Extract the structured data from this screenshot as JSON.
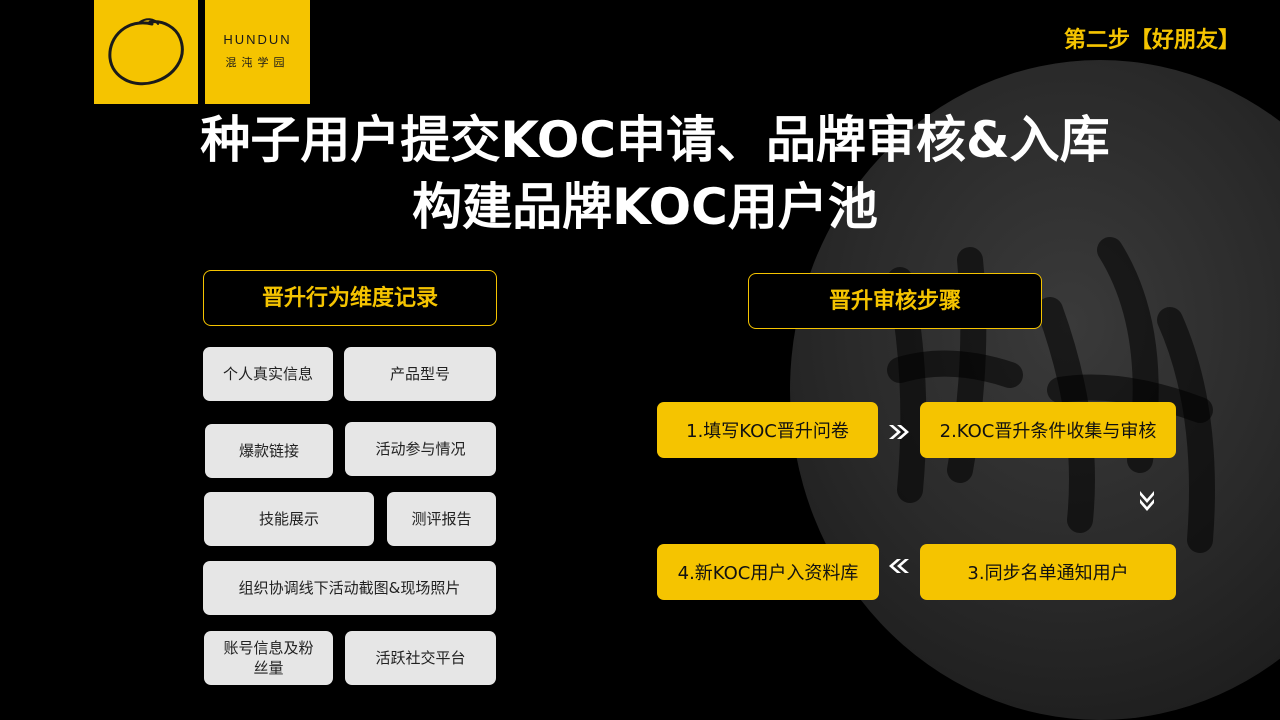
{
  "logo": {
    "en": "HUNDUN",
    "cn": "混沌学园"
  },
  "step_label": "第二步【好朋友】",
  "title": {
    "line1": "种子用户提交KOC申请、品牌审核&入库",
    "line2": "构建品牌KOC用户池"
  },
  "left": {
    "header": "晋升行为维度记录",
    "items": [
      "个人真实信息",
      "产品型号",
      "爆款链接",
      "活动参与情况",
      "技能展示",
      "测评报告",
      "组织协调线下活动截图&现场照片",
      "账号信息及粉丝量",
      "活跃社交平台"
    ]
  },
  "right": {
    "header": "晋升审核步骤",
    "steps": [
      "1.填写KOC晋升问卷",
      "2.KOC晋升条件收集与审核",
      "3.同步名单通知用户",
      "4.新KOC用户入资料库"
    ]
  },
  "colors": {
    "accent": "#f5c400",
    "chip": "#e6e6e6",
    "background": "#000000"
  },
  "icons": {
    "logo": "enso-circle-icon",
    "arrow_right": "double-chevron-right-icon",
    "arrow_down": "double-chevron-down-icon",
    "arrow_left": "double-chevron-left-icon"
  }
}
